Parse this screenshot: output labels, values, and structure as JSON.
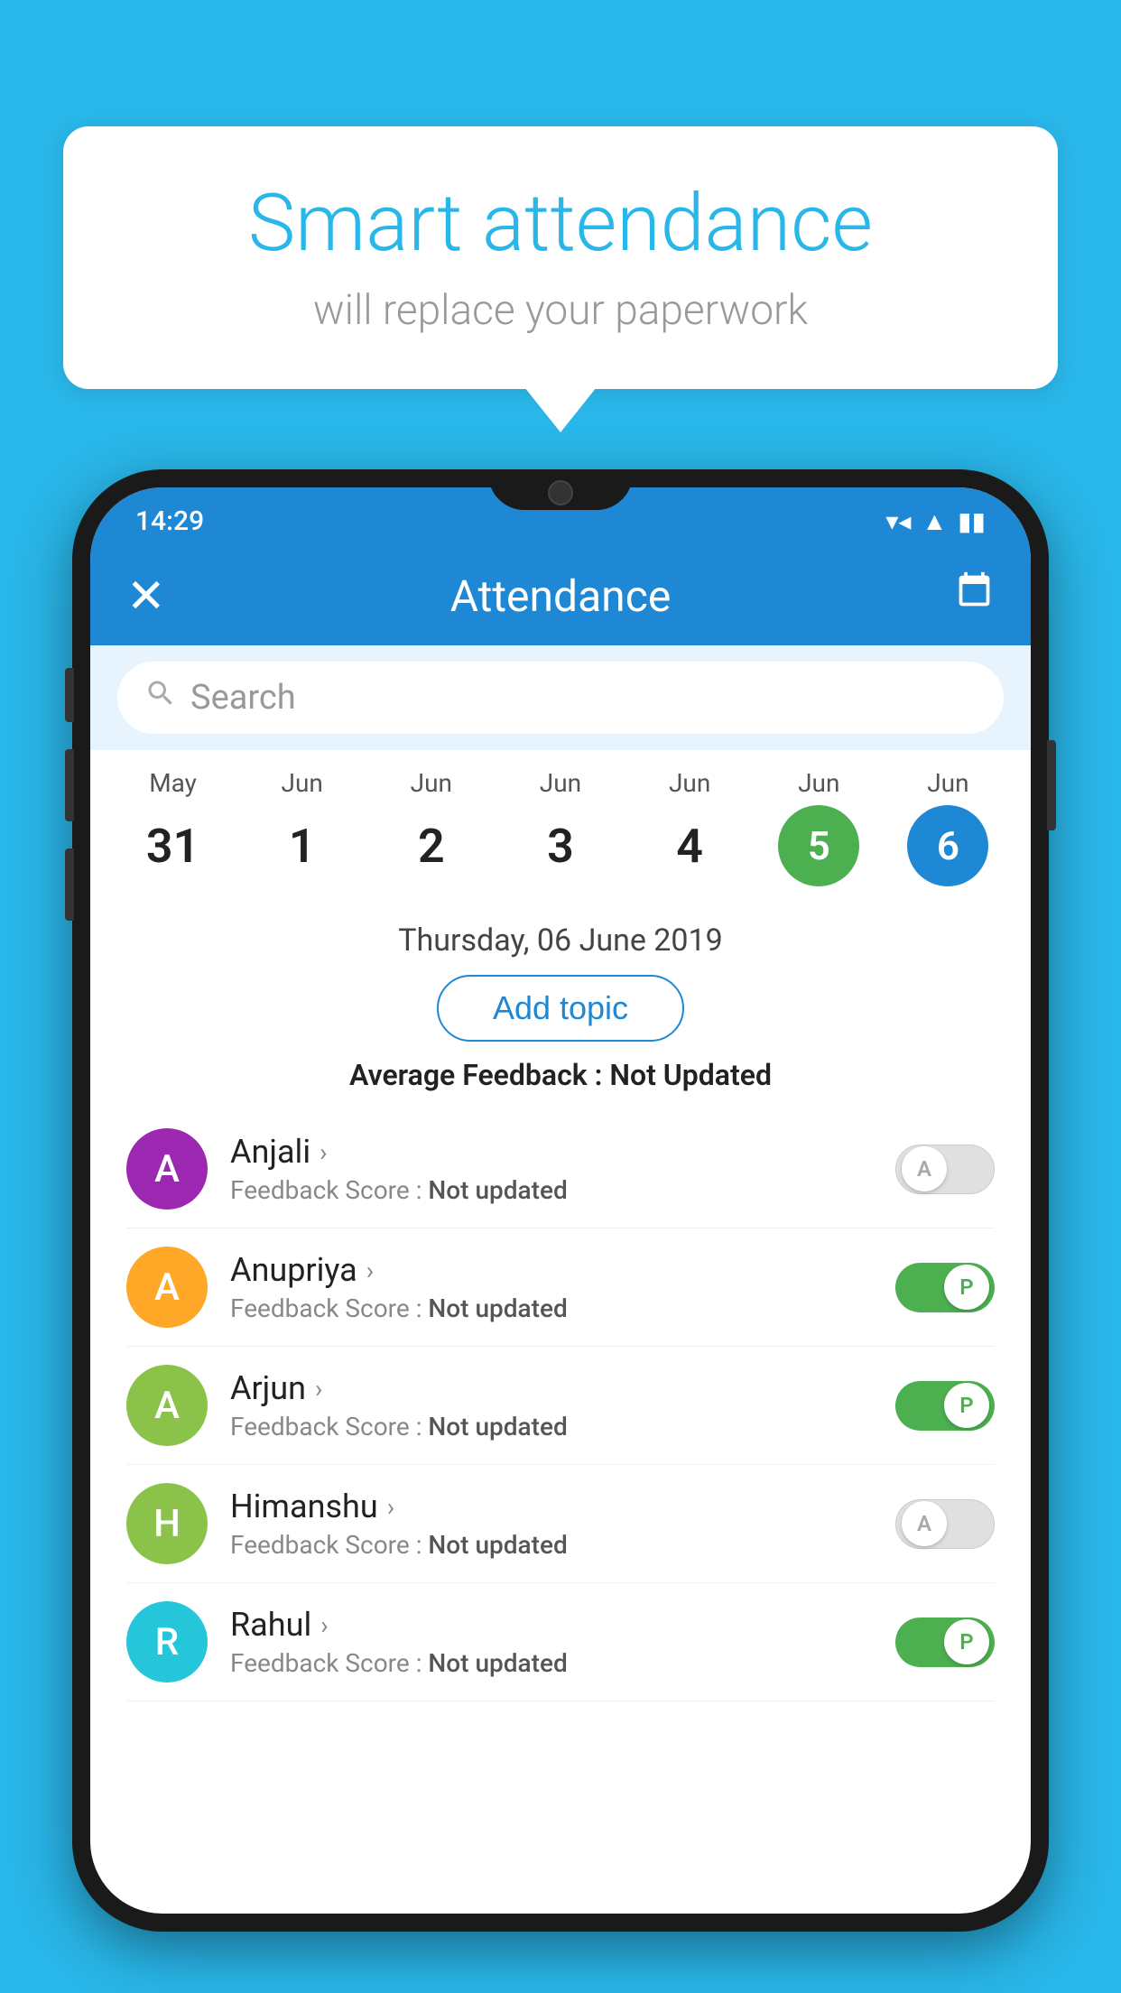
{
  "background_color": "#29b6e8",
  "speech_bubble": {
    "title": "Smart attendance",
    "subtitle": "will replace your paperwork"
  },
  "status_bar": {
    "time": "14:29",
    "wifi": "▼",
    "signal": "◀",
    "battery": "▮"
  },
  "app_bar": {
    "title": "Attendance",
    "close_label": "✕",
    "calendar_icon": "📅"
  },
  "search": {
    "placeholder": "Search"
  },
  "calendar": {
    "days": [
      {
        "month": "May",
        "date": "31",
        "style": "normal"
      },
      {
        "month": "Jun",
        "date": "1",
        "style": "normal"
      },
      {
        "month": "Jun",
        "date": "2",
        "style": "normal"
      },
      {
        "month": "Jun",
        "date": "3",
        "style": "normal"
      },
      {
        "month": "Jun",
        "date": "4",
        "style": "normal"
      },
      {
        "month": "Jun",
        "date": "5",
        "style": "today"
      },
      {
        "month": "Jun",
        "date": "6",
        "style": "selected"
      }
    ]
  },
  "selected_date": "Thursday, 06 June 2019",
  "add_topic_label": "Add topic",
  "avg_feedback_label": "Average Feedback : ",
  "avg_feedback_value": "Not Updated",
  "students": [
    {
      "name": "Anjali",
      "avatar_letter": "A",
      "avatar_color": "#9c27b0",
      "feedback_label": "Feedback Score : ",
      "feedback_value": "Not updated",
      "toggle_state": "off",
      "toggle_label": "A"
    },
    {
      "name": "Anupriya",
      "avatar_letter": "A",
      "avatar_color": "#ffa726",
      "feedback_label": "Feedback Score : ",
      "feedback_value": "Not updated",
      "toggle_state": "on",
      "toggle_label": "P"
    },
    {
      "name": "Arjun",
      "avatar_letter": "A",
      "avatar_color": "#8bc34a",
      "feedback_label": "Feedback Score : ",
      "feedback_value": "Not updated",
      "toggle_state": "on",
      "toggle_label": "P"
    },
    {
      "name": "Himanshu",
      "avatar_letter": "H",
      "avatar_color": "#8bc34a",
      "feedback_label": "Feedback Score : ",
      "feedback_value": "Not updated",
      "toggle_state": "off",
      "toggle_label": "A"
    },
    {
      "name": "Rahul",
      "avatar_letter": "R",
      "avatar_color": "#26c6da",
      "feedback_label": "Feedback Score : ",
      "feedback_value": "Not updated",
      "toggle_state": "on",
      "toggle_label": "P"
    }
  ]
}
